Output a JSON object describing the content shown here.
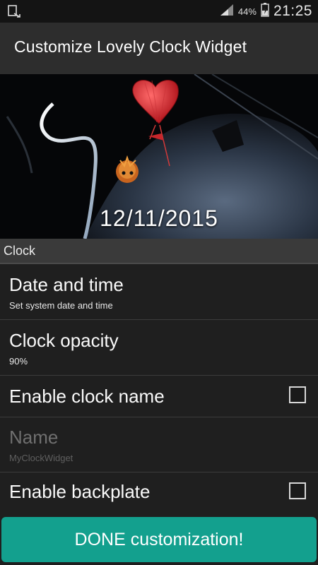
{
  "status_bar": {
    "battery_percent": "44%",
    "time": "21:25",
    "notification_icon": "screen-notification-icon",
    "signal_icon": "signal-icon",
    "battery_icon": "battery-charging-icon"
  },
  "action_bar": {
    "title": "Customize Lovely Clock Widget"
  },
  "preview": {
    "date": "12/11/2015"
  },
  "section": {
    "header": "Clock"
  },
  "preferences": [
    {
      "title": "Date and time",
      "summary": "Set system date and time"
    },
    {
      "title": "Clock opacity",
      "summary": "90%"
    },
    {
      "title": "Enable clock name",
      "checked": false
    },
    {
      "title": "Name",
      "summary": "MyClockWidget",
      "enabled": false
    },
    {
      "title": "Enable backplate",
      "checked": false
    }
  ],
  "done_button": {
    "label": "DONE customization!"
  },
  "colors": {
    "accent": "#13a08e",
    "background": "#1f1f1f",
    "action_bar": "#2d2d2d",
    "section_header": "#3a3a3a"
  }
}
